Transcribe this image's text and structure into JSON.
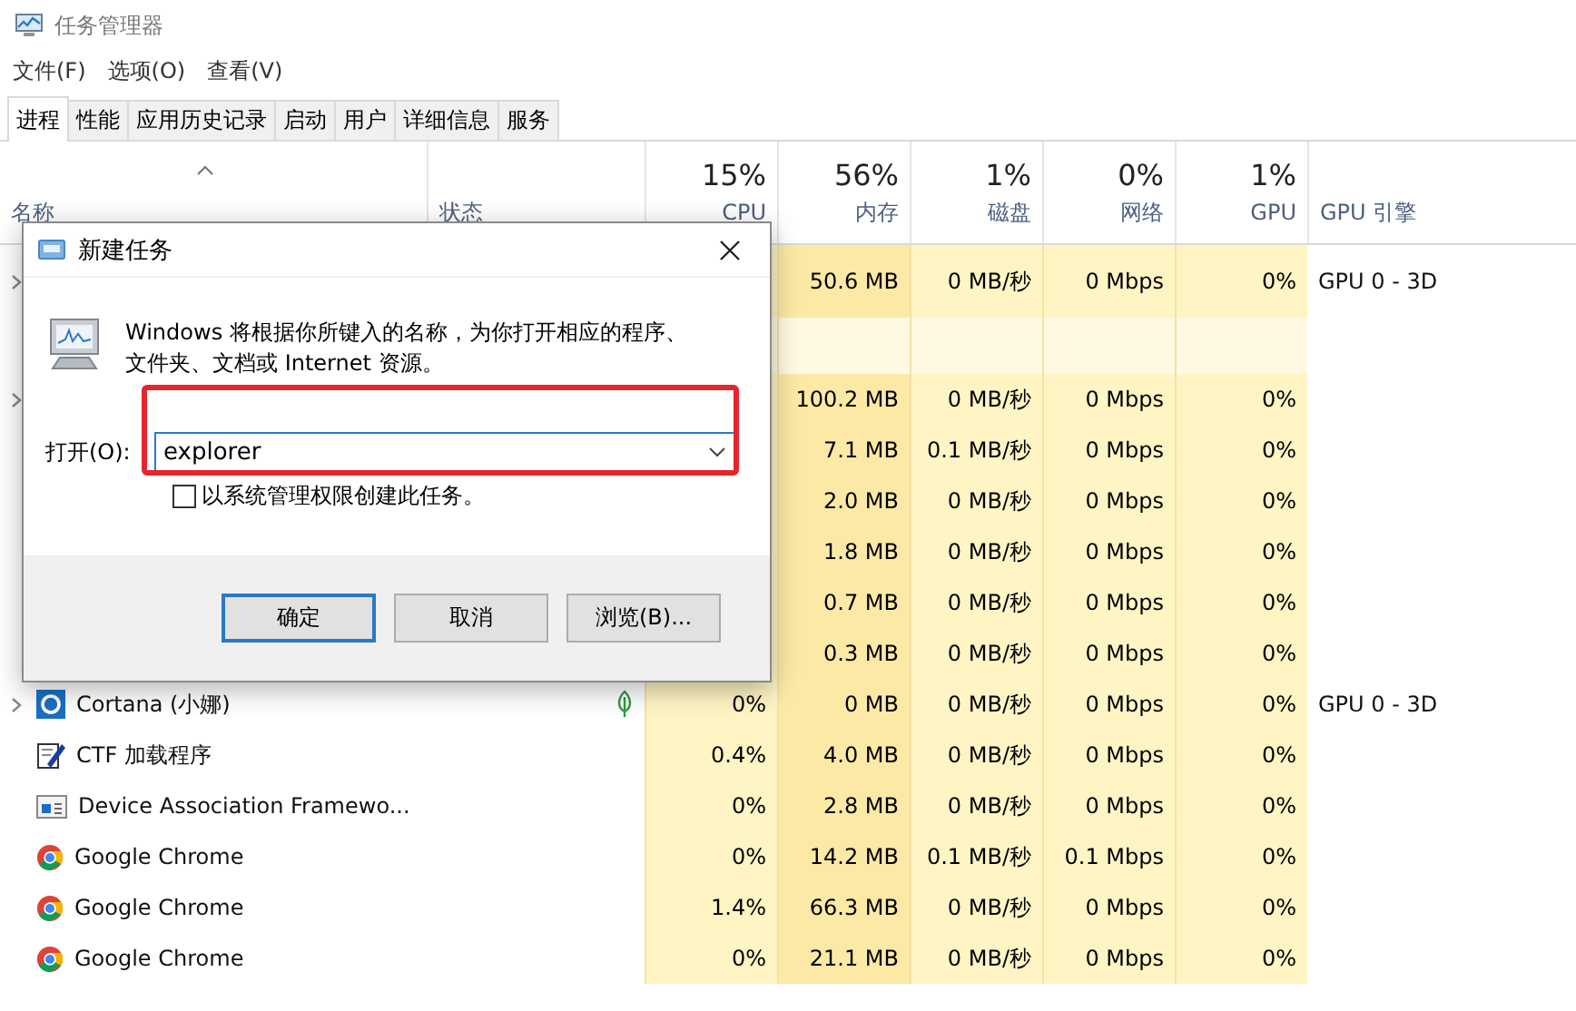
{
  "window": {
    "title": "任务管理器"
  },
  "menu": [
    "文件(F)",
    "选项(O)",
    "查看(V)"
  ],
  "tabs": [
    {
      "label": "进程",
      "selected": true
    },
    {
      "label": "性能",
      "selected": false
    },
    {
      "label": "应用历史记录",
      "selected": false
    },
    {
      "label": "启动",
      "selected": false
    },
    {
      "label": "用户",
      "selected": false
    },
    {
      "label": "详细信息",
      "selected": false
    },
    {
      "label": "服务",
      "selected": false
    }
  ],
  "table": {
    "columns": [
      {
        "label": "名称"
      },
      {
        "label": "状态"
      },
      {
        "percent": "15%",
        "label": "CPU"
      },
      {
        "percent": "56%",
        "label": "内存"
      },
      {
        "percent": "1%",
        "label": "磁盘"
      },
      {
        "percent": "0%",
        "label": "网络"
      },
      {
        "percent": "1%",
        "label": "GPU"
      },
      {
        "label": "GPU 引擎"
      }
    ],
    "rows": [
      {
        "kind": "process",
        "expandable": true,
        "mem": "50.6 MB",
        "disk": "0 MB/秒",
        "net": "0 Mbps",
        "gpu": "0%",
        "engine": "GPU 0 - 3D"
      },
      {
        "kind": "group"
      },
      {
        "kind": "process",
        "expandable": true,
        "mem": "100.2 MB",
        "disk": "0 MB/秒",
        "net": "0 Mbps",
        "gpu": "0%"
      },
      {
        "kind": "process",
        "expandable": false,
        "mem": "7.1 MB",
        "disk": "0.1 MB/秒",
        "net": "0 Mbps",
        "gpu": "0%"
      },
      {
        "kind": "process",
        "expandable": false,
        "mem": "2.0 MB",
        "disk": "0 MB/秒",
        "net": "0 Mbps",
        "gpu": "0%"
      },
      {
        "kind": "process",
        "expandable": false,
        "mem": "1.8 MB",
        "disk": "0 MB/秒",
        "net": "0 Mbps",
        "gpu": "0%"
      },
      {
        "kind": "process",
        "expandable": false,
        "mem": "0.7 MB",
        "disk": "0 MB/秒",
        "net": "0 Mbps",
        "gpu": "0%"
      },
      {
        "kind": "process",
        "expandable": false,
        "mem": "0.3 MB",
        "disk": "0 MB/秒",
        "net": "0 Mbps",
        "gpu": "0%"
      },
      {
        "kind": "cortana",
        "expandable": true,
        "name": "Cortana (小娜)",
        "suspended": true,
        "cpu": "0%",
        "mem": "0 MB",
        "disk": "0 MB/秒",
        "net": "0 Mbps",
        "gpu": "0%",
        "engine": "GPU 0 - 3D"
      },
      {
        "kind": "ctf",
        "expandable": false,
        "name": "CTF 加载程序",
        "suspended": false,
        "cpu": "0.4%",
        "mem": "4.0 MB",
        "disk": "0 MB/秒",
        "net": "0 Mbps",
        "gpu": "0%"
      },
      {
        "kind": "window",
        "expandable": false,
        "name": "Device Association Framewo...",
        "suspended": false,
        "cpu": "0%",
        "mem": "2.8 MB",
        "disk": "0 MB/秒",
        "net": "0 Mbps",
        "gpu": "0%"
      },
      {
        "kind": "chrome",
        "expandable": false,
        "name": "Google Chrome",
        "suspended": false,
        "cpu": "0%",
        "mem": "14.2 MB",
        "disk": "0.1 MB/秒",
        "net": "0.1 Mbps",
        "gpu": "0%"
      },
      {
        "kind": "chrome",
        "expandable": false,
        "name": "Google Chrome",
        "suspended": false,
        "cpu": "1.4%",
        "mem": "66.3 MB",
        "disk": "0 MB/秒",
        "net": "0 Mbps",
        "gpu": "0%"
      },
      {
        "kind": "chrome",
        "expandable": false,
        "name": "Google Chrome",
        "suspended": false,
        "cpu": "0%",
        "mem": "21.1 MB",
        "disk": "0 MB/秒",
        "net": "0 Mbps",
        "gpu": "0%"
      }
    ]
  },
  "dialog": {
    "title": "新建任务",
    "message": "Windows 将根据你所键入的名称，为你打开相应的程序、文件夹、文档或 Internet 资源。",
    "open_label": "打开(O):",
    "open_value": "explorer",
    "admin_checkbox": {
      "label": "以系统管理权限创建此任务。",
      "checked": false
    },
    "buttons": [
      {
        "label": "确定",
        "default": true
      },
      {
        "label": "取消",
        "default": false
      },
      {
        "label": "浏览(B)...",
        "default": false
      }
    ]
  }
}
